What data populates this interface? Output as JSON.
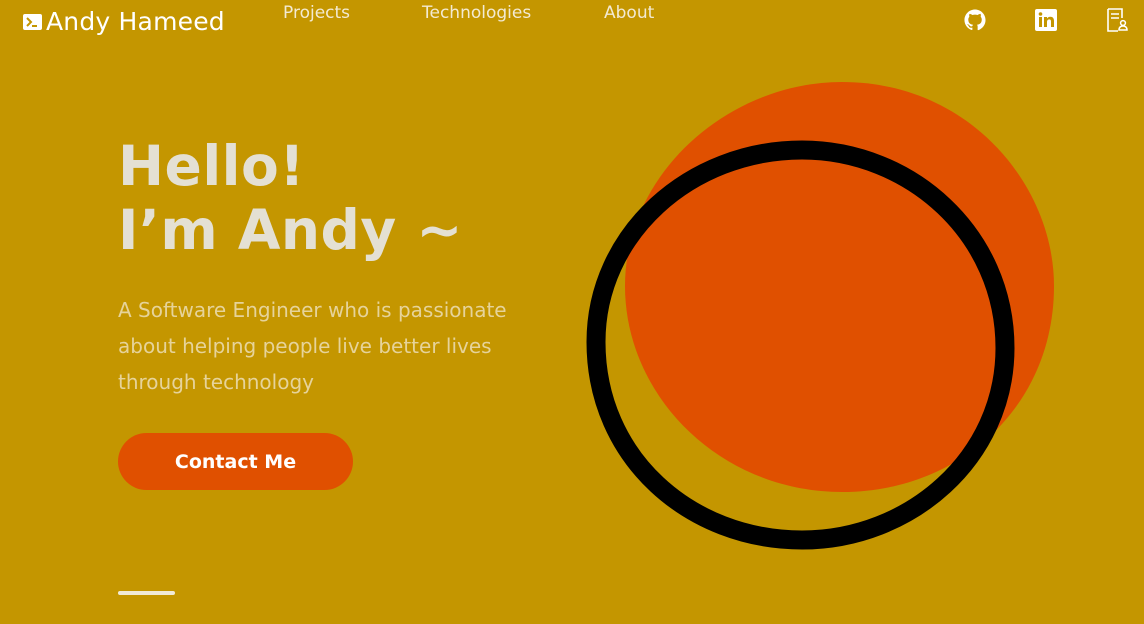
{
  "header": {
    "brand_name": "Andy Hameed",
    "nav": [
      {
        "label": "Projects"
      },
      {
        "label": "Technologies"
      },
      {
        "label": "About"
      }
    ],
    "social_icons": [
      "github-icon",
      "linkedin-icon",
      "resume-icon"
    ]
  },
  "hero": {
    "title_line1": "Hello!",
    "title_line2": "I’m Andy ~",
    "subtitle": "A Software Engineer who is passionate about helping people live better lives through technology",
    "contact_label": "Contact Me"
  },
  "colors": {
    "background": "#c49600",
    "accent": "#e05000",
    "ring": "#000000",
    "title": "#e4e0d3",
    "subtitle": "#e6d39a"
  }
}
